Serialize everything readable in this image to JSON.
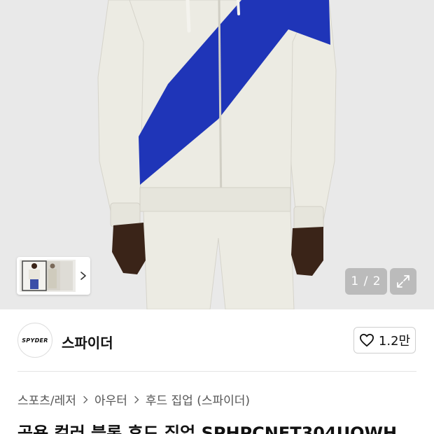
{
  "gallery": {
    "counter": "1 / 2",
    "background": "#e9e9e9",
    "hoodie_colors": {
      "body": "#ecebe3",
      "stripe": "#1f35b8",
      "skin": "#3a2418"
    }
  },
  "brand": {
    "logo_text": "SPYDER",
    "name": "스파이더",
    "like_count": "1.2만"
  },
  "breadcrumb": {
    "items": [
      "스포츠/레저",
      "아우터",
      "후드 집업 (스파이더)"
    ]
  },
  "product": {
    "title": "공용 컬러 블록 후드 집업 SPHPCNFT304UOWH"
  }
}
